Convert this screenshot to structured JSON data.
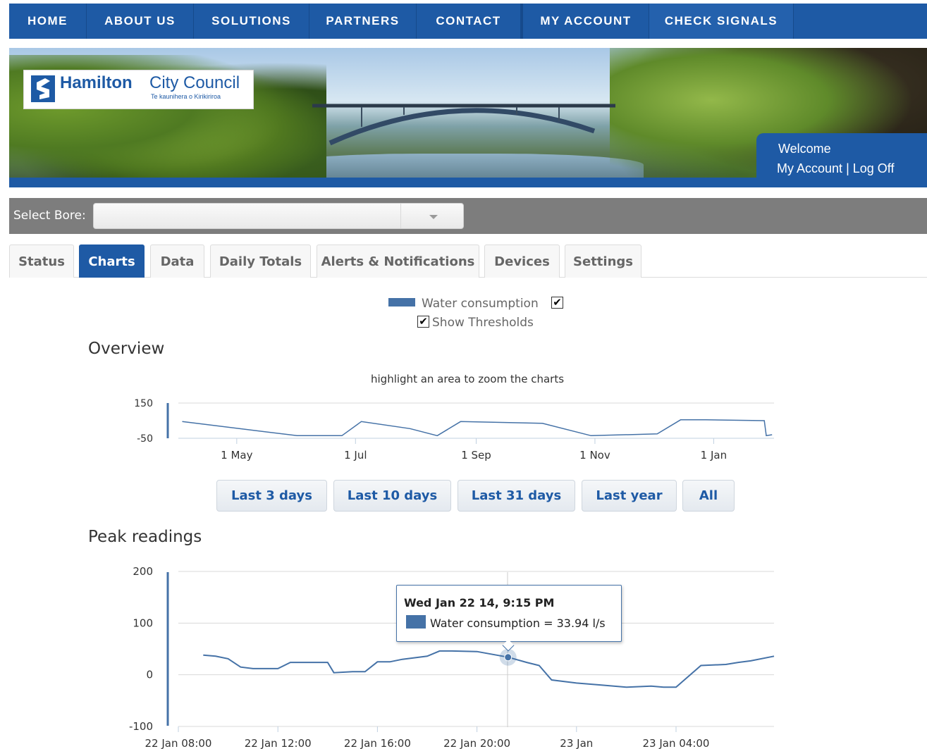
{
  "nav": {
    "items": [
      {
        "label": "HOME"
      },
      {
        "label": "ABOUT US"
      },
      {
        "label": "SOLUTIONS"
      },
      {
        "label": "PARTNERS"
      },
      {
        "label": "CONTACT"
      },
      {
        "label": "MY ACCOUNT"
      },
      {
        "label": "CHECK SIGNALS"
      }
    ]
  },
  "banner": {
    "logo_brand_bold": "Hamilton",
    "logo_brand_light": "City Council",
    "logo_tagline": "Te kaunihera o Kirikiriroa",
    "welcome": "Welcome",
    "my_account_link": "My Account",
    "separator": "|",
    "log_off_link": "Log Off"
  },
  "bore_select": {
    "label": "Select Bore:",
    "value": ""
  },
  "tabs": [
    {
      "label": "Status",
      "active": false
    },
    {
      "label": "Charts",
      "active": true
    },
    {
      "label": "Data",
      "active": false
    },
    {
      "label": "Daily Totals",
      "active": false
    },
    {
      "label": "Alerts & Notifications",
      "active": false
    },
    {
      "label": "Devices",
      "active": false
    },
    {
      "label": "Settings",
      "active": false
    }
  ],
  "legend": {
    "series_label": "Water consumption",
    "series_checked": true,
    "series_color": "#4572a7",
    "thresholds_label": "Show Thresholds",
    "thresholds_checked": true
  },
  "overview": {
    "title": "Overview",
    "hint": "highlight an area to zoom the charts"
  },
  "range_buttons": [
    "Last 3 days",
    "Last 10 days",
    "Last 31 days",
    "Last year",
    "All"
  ],
  "peak": {
    "title": "Peak readings"
  },
  "tooltip": {
    "title": "Wed Jan 22 14, 9:15 PM",
    "series": "Water consumption",
    "equals": "=",
    "value": "33.94 l/s"
  },
  "colors": {
    "brand_blue": "#1e5aa5",
    "series": "#4572a7",
    "grid": "#d8d8d8"
  },
  "chart_data": [
    {
      "type": "line",
      "title": "",
      "xlabel": "",
      "ylabel": "",
      "x_tick_labels": [
        "1 May",
        "1 Jul",
        "1 Sep",
        "1 Nov",
        "1 Jan"
      ],
      "y_tick_labels": [
        "150",
        "-50"
      ],
      "ylim": [
        -50,
        150
      ],
      "x": [
        "~3 Apr",
        "~1 Jun",
        "~24 Jun",
        "~4 Jul",
        "~29 Jul",
        "~12 Aug",
        "~24 Aug",
        "~5 Oct",
        "~30 Oct",
        "~3 Dec",
        "~15 Dec",
        "~28 Dec",
        "~27 Jan",
        "~28 Jan",
        "~31 Jan"
      ],
      "series": [
        {
          "values": [
            45,
            -35,
            -35,
            45,
            5,
            -35,
            45,
            35,
            -35,
            -25,
            55,
            55,
            50,
            -35,
            -30
          ]
        }
      ]
    },
    {
      "type": "line",
      "title": "",
      "xlabel": "",
      "ylabel": "",
      "x_tick_labels": [
        "22 Jan 08:00",
        "22 Jan 12:00",
        "22 Jan 16:00",
        "22 Jan 20:00",
        "23 Jan",
        "23 Jan 04:00"
      ],
      "y_tick_labels": [
        "200",
        "100",
        "0",
        "-100"
      ],
      "ylim": [
        -100,
        200
      ],
      "x": [
        "22 Jan 09:00",
        "22 Jan 09:30",
        "22 Jan 10:00",
        "22 Jan 10:30",
        "22 Jan 11:00",
        "22 Jan 12:00",
        "22 Jan 12:30",
        "22 Jan 13:00",
        "22 Jan 14:00",
        "22 Jan 14:15",
        "22 Jan 15:00",
        "22 Jan 15:30",
        "22 Jan 16:00",
        "22 Jan 16:30",
        "22 Jan 17:00",
        "22 Jan 18:00",
        "22 Jan 18:30",
        "22 Jan 19:00",
        "22 Jan 20:00",
        "22 Jan 21:15",
        "22 Jan 22:00",
        "22 Jan 22:30",
        "22 Jan 23:00",
        "23 Jan 00:00",
        "23 Jan 01:00",
        "23 Jan 02:00",
        "23 Jan 03:00",
        "23 Jan 03:30",
        "23 Jan 04:00",
        "23 Jan 05:00",
        "23 Jan 06:00",
        "23 Jan 06:30",
        "23 Jan 07:00",
        "23 Jan 08:00"
      ],
      "series": [
        {
          "name": "Water consumption",
          "values": [
            38,
            36,
            31,
            15,
            12,
            12,
            24,
            24,
            24,
            4,
            6,
            6,
            25,
            25,
            30,
            36,
            46,
            46,
            45,
            34,
            24,
            18,
            -10,
            -16,
            -20,
            -24,
            -22,
            -24,
            -24,
            18,
            20,
            24,
            27,
            36
          ]
        }
      ],
      "highlighted_point": {
        "x": "22 Jan 21:15",
        "y": 33.94
      }
    }
  ]
}
